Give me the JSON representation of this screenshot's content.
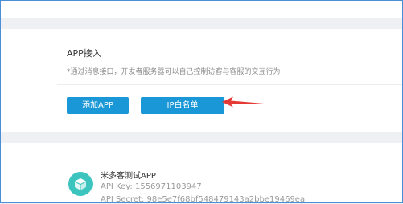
{
  "access": {
    "title": "APP接入",
    "description": "*通过消息接口，开发者服务器可以自己控制访客与客服的交互行为",
    "add_app_label": "添加APP",
    "ip_whitelist_label": "IP白名单"
  },
  "app": {
    "name": "米多客测试APP",
    "key_label": "API Key:",
    "key_value": "1556971103947",
    "secret_label": "API Secret:",
    "secret_value": "98e5e7f68bf548479143a2bbe19469ea",
    "logo_color": "#3cc5be"
  },
  "colors": {
    "primary_button": "#1a97d6",
    "arrow": "#e53935"
  }
}
